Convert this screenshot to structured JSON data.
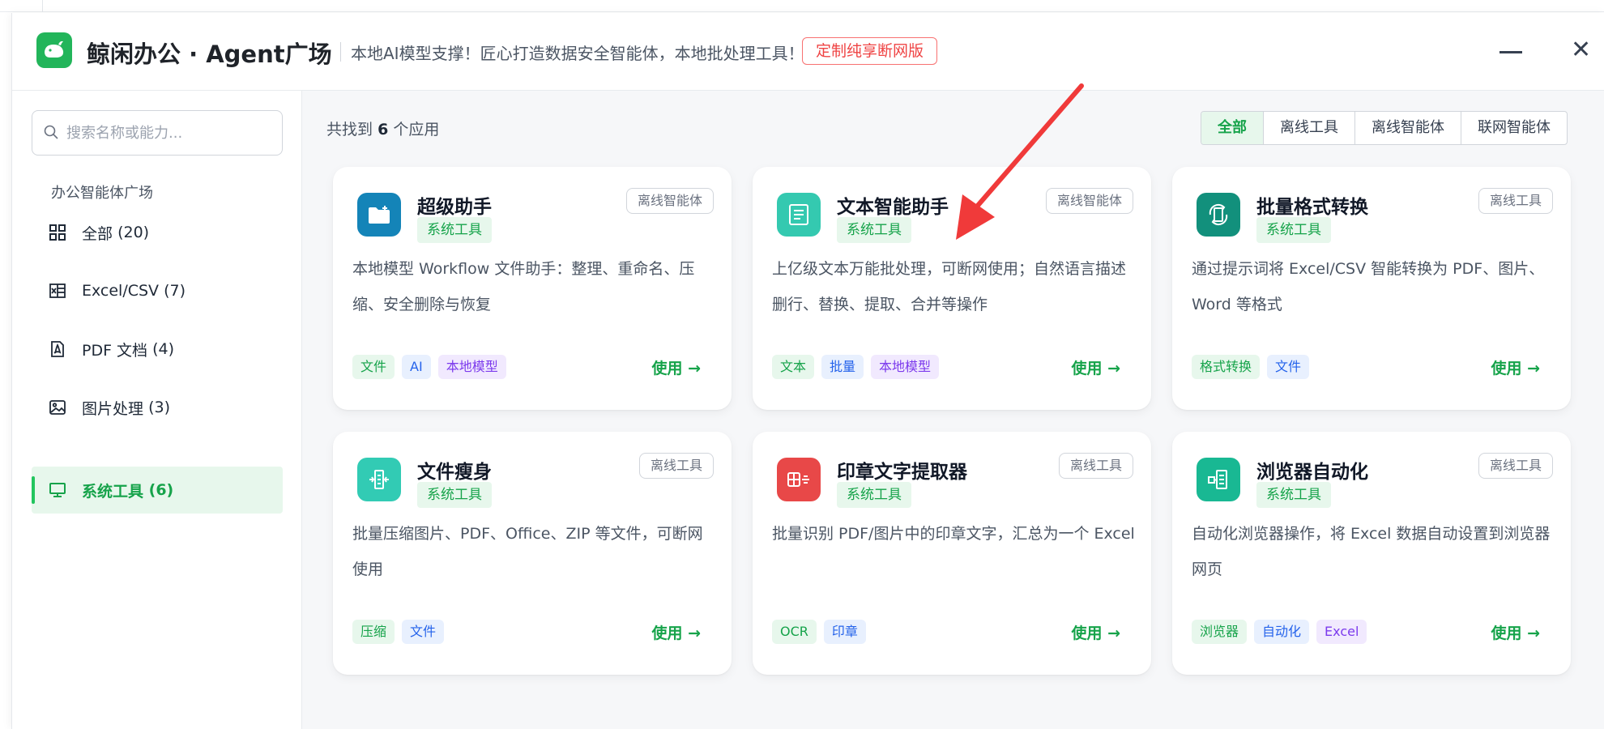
{
  "header": {
    "app_title": "鲸闲办公 · Agent广场",
    "subtitle": "本地AI模型支撑！匠心打造数据安全智能体，本地批处理工具！",
    "promo_button": "定制纯享断网版",
    "minimize_icon": "minimize-icon",
    "close_icon": "close-icon"
  },
  "sidebar": {
    "search_placeholder": "搜索名称或能力...",
    "section_title": "办公智能体广场",
    "items": [
      {
        "label": "全部",
        "count": "(20)",
        "icon": "grid-icon",
        "active": false
      },
      {
        "label": "Excel/CSV",
        "count": "(7)",
        "icon": "excel-icon",
        "active": false
      },
      {
        "label": "PDF 文档",
        "count": "(4)",
        "icon": "pdf-icon",
        "active": false
      },
      {
        "label": "图片处理",
        "count": "(3)",
        "icon": "image-icon",
        "active": false
      },
      {
        "label": "系统工具",
        "count": "(6)",
        "icon": "monitor-icon",
        "active": true
      }
    ]
  },
  "main": {
    "result_prefix": "共找到",
    "result_count": "6",
    "result_suffix": "个应用",
    "filters": [
      {
        "label": "全部",
        "active": true
      },
      {
        "label": "离线工具",
        "active": false
      },
      {
        "label": "离线智能体",
        "active": false
      },
      {
        "label": "联网智能体",
        "active": false
      }
    ],
    "use_label": "使用 →",
    "cards": [
      {
        "title": "超级助手",
        "badge": "系统工具",
        "type": "离线智能体",
        "description": "本地模型 Workflow 文件助手：整理、重命名、压缩、安全删除与恢复",
        "icon": "folder-icon",
        "icon_color": "#1484b8",
        "tags": [
          {
            "text": "文件",
            "color": "green"
          },
          {
            "text": "AI",
            "color": "blue"
          },
          {
            "text": "本地模型",
            "color": "purple"
          }
        ]
      },
      {
        "title": "文本智能助手",
        "badge": "系统工具",
        "type": "离线智能体",
        "description": "上亿级文本万能批处理，可断网使用；自然语言描述删行、替换、提取、合并等操作",
        "icon": "text-document-icon",
        "icon_color": "#34c9b0",
        "tags": [
          {
            "text": "文本",
            "color": "green"
          },
          {
            "text": "批量",
            "color": "blue"
          },
          {
            "text": "本地模型",
            "color": "purple"
          }
        ]
      },
      {
        "title": "批量格式转换",
        "badge": "系统工具",
        "type": "离线工具",
        "description": "通过提示词将 Excel/CSV 智能转换为 PDF、图片、Word 等格式",
        "icon": "convert-icon",
        "icon_color": "#12907c",
        "tags": [
          {
            "text": "格式转换",
            "color": "green"
          },
          {
            "text": "文件",
            "color": "blue"
          }
        ]
      },
      {
        "title": "文件瘦身",
        "badge": "系统工具",
        "type": "离线工具",
        "description": "批量压缩图片、PDF、Office、ZIP 等文件，可断网使用",
        "icon": "compress-icon",
        "icon_color": "#32cbb4",
        "tags": [
          {
            "text": "压缩",
            "color": "green"
          },
          {
            "text": "文件",
            "color": "blue"
          }
        ]
      },
      {
        "title": "印章文字提取器",
        "badge": "系统工具",
        "type": "离线工具",
        "description": "批量识别 PDF/图片中的印章文字，汇总为一个 Excel",
        "icon": "stamp-icon",
        "icon_color": "#e84848",
        "tags": [
          {
            "text": "OCR",
            "color": "green"
          },
          {
            "text": "印章",
            "color": "blue"
          }
        ]
      },
      {
        "title": "浏览器自动化",
        "badge": "系统工具",
        "type": "离线工具",
        "description": "自动化浏览器操作，将 Excel 数据自动设置到浏览器网页",
        "icon": "browser-automation-icon",
        "icon_color": "#19b893",
        "tags": [
          {
            "text": "浏览器",
            "color": "green"
          },
          {
            "text": "自动化",
            "color": "blue"
          },
          {
            "text": "Excel",
            "color": "purple"
          }
        ]
      }
    ]
  },
  "annotation": {
    "arrow_color": "#f03a3a"
  }
}
